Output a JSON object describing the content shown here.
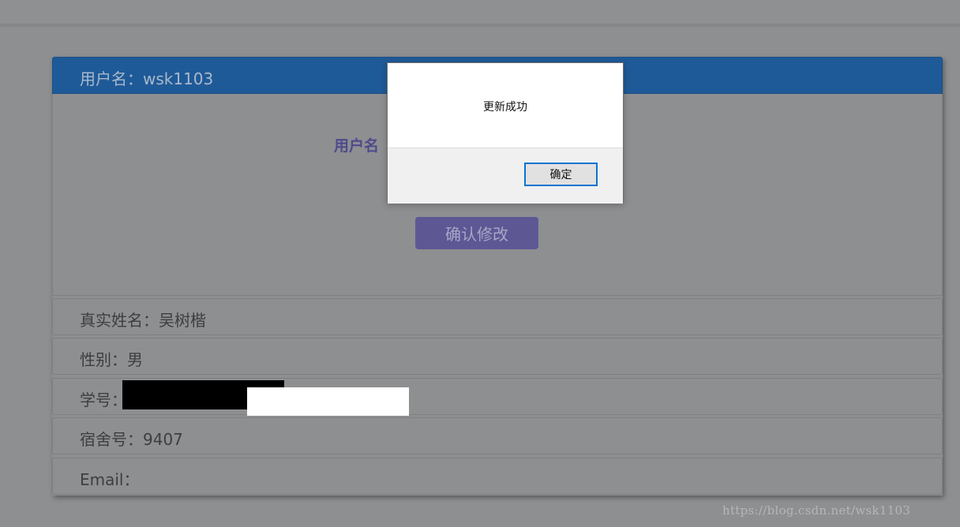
{
  "panel": {
    "header_text": "用户名：wsk1103",
    "form_label": "用户名",
    "confirm_button": "确认修改"
  },
  "info_rows": [
    "真实姓名：吴树楷",
    "性别：男",
    "学号：",
    "宿舍号：9407",
    "Email："
  ],
  "dialog": {
    "message": "更新成功",
    "ok_label": "确定"
  },
  "watermark": "https://blog.csdn.net/wsk1103",
  "colors": {
    "header_blue": "#1f5a98",
    "button_purple": "#5d5894",
    "overlay_gray": "#8e8f91",
    "ok_focus_border": "#0a74d1"
  }
}
